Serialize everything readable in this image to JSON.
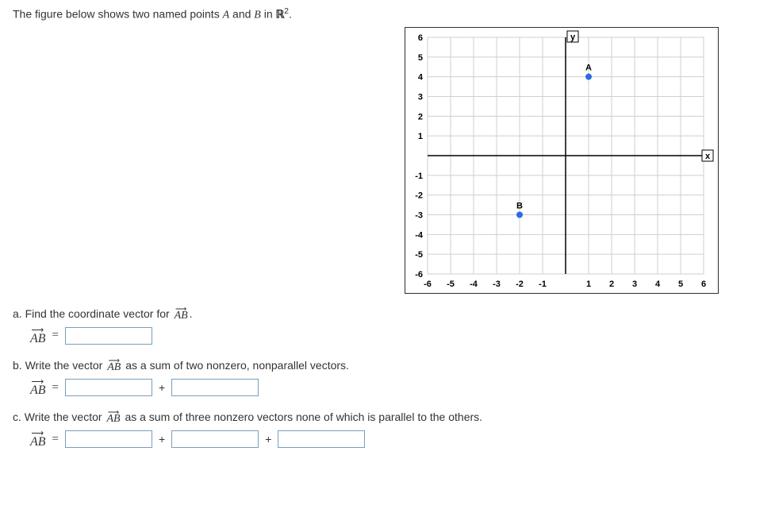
{
  "intro": {
    "prefix": "The figure below shows two named points ",
    "pointA": "A",
    "and": " and ",
    "pointB": "B",
    "in": " in ",
    "space": "ℝ",
    "exp": "2",
    "period": "."
  },
  "chart_data": {
    "type": "scatter",
    "x_range": [
      -6,
      6
    ],
    "y_range": [
      -6,
      6
    ],
    "x_ticks_neg": [
      -6,
      -5,
      -4,
      -3,
      -2,
      -1
    ],
    "x_ticks_pos": [
      1,
      2,
      3,
      4,
      5,
      6
    ],
    "y_ticks_neg": [
      -6,
      -5,
      -4,
      -3,
      -2,
      -1
    ],
    "y_ticks_pos": [
      1,
      2,
      3,
      4,
      5,
      6
    ],
    "xlabel": "x",
    "ylabel": "y",
    "points": [
      {
        "name": "A",
        "x": 1,
        "y": 4
      },
      {
        "name": "B",
        "x": -2,
        "y": -3
      }
    ]
  },
  "parts": {
    "a": {
      "prefix": "a. Find the coordinate vector for ",
      "suffix": "."
    },
    "b": {
      "prefix": "b. Write the vector ",
      "suffix": " as a sum of two nonzero, nonparallel vectors."
    },
    "c": {
      "prefix": "c. Write the vector ",
      "suffix": " as a sum of three nonzero vectors none of which is parallel to the others."
    }
  },
  "symbols": {
    "ab": "AB",
    "arrow": "⟶",
    "eq": "=",
    "plus": "+"
  }
}
